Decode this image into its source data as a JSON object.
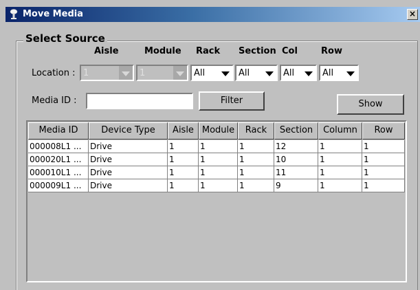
{
  "window": {
    "title": "Move Media",
    "close_glyph": "×"
  },
  "group": {
    "title": "Select Source"
  },
  "location": {
    "label": "Location :",
    "columns": [
      "Aisle",
      "Module",
      "Rack",
      "Section",
      "Col",
      "Row"
    ],
    "aisle_value": "1",
    "module_value": "1",
    "rack_value": "All",
    "section_value": "All",
    "col_value": "All",
    "row_value": "All"
  },
  "media_id": {
    "label": "Media ID :",
    "value": ""
  },
  "buttons": {
    "filter": "Filter",
    "show": "Show"
  },
  "table": {
    "headers": [
      "Media ID",
      "Device Type",
      "Aisle",
      "Module",
      "Rack",
      "Section",
      "Column",
      "Row"
    ],
    "rows": [
      [
        "000008L1 ...",
        "Drive",
        "1",
        "1",
        "1",
        "12",
        "1",
        "1"
      ],
      [
        "000020L1 ...",
        "Drive",
        "1",
        "1",
        "1",
        "10",
        "1",
        "1"
      ],
      [
        "000010L1 ...",
        "Drive",
        "1",
        "1",
        "1",
        "11",
        "1",
        "1"
      ],
      [
        "000009L1 ...",
        "Drive",
        "1",
        "1",
        "1",
        "9",
        "1",
        "1"
      ]
    ]
  }
}
